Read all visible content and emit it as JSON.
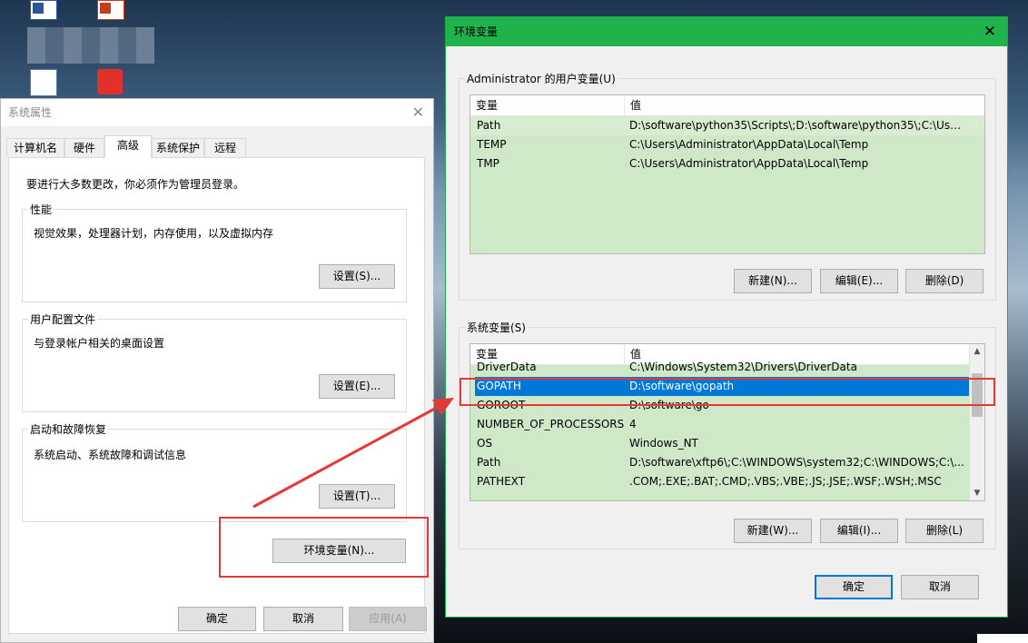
{
  "system_properties": {
    "title": "系统属性",
    "tabs": [
      {
        "label": "计算机名"
      },
      {
        "label": "硬件"
      },
      {
        "label": "高级"
      },
      {
        "label": "系统保护"
      },
      {
        "label": "远程"
      }
    ],
    "notice": "要进行大多数更改，你必须作为管理员登录。",
    "performance": {
      "label": "性能",
      "desc": "视觉效果，处理器计划，内存使用，以及虚拟内存",
      "button": "设置(S)..."
    },
    "user_profiles": {
      "label": "用户配置文件",
      "desc": "与登录帐户相关的桌面设置",
      "button": "设置(E)..."
    },
    "startup_recovery": {
      "label": "启动和故障恢复",
      "desc": "系统启动、系统故障和调试信息",
      "button": "设置(T)..."
    },
    "env_button": "环境变量(N)...",
    "ok": "确定",
    "cancel": "取消",
    "apply": "应用(A)"
  },
  "env_vars": {
    "title": "环境变量",
    "user_group_label": "Administrator 的用户变量(U)",
    "system_group_label": "系统变量(S)",
    "col_var": "变量",
    "col_val": "值",
    "user_rows": [
      {
        "name": "Path",
        "value": "D:\\software\\python35\\Scripts\\;D:\\software\\python35\\;C:\\User..."
      },
      {
        "name": "TEMP",
        "value": "C:\\Users\\Administrator\\AppData\\Local\\Temp"
      },
      {
        "name": "TMP",
        "value": "C:\\Users\\Administrator\\AppData\\Local\\Temp"
      }
    ],
    "system_rows": [
      {
        "name": "DriverData",
        "value": "C:\\Windows\\System32\\Drivers\\DriverData"
      },
      {
        "name": "GOPATH",
        "value": "D:\\software\\gopath"
      },
      {
        "name": "GOROOT",
        "value": "D:\\software\\go"
      },
      {
        "name": "NUMBER_OF_PROCESSORS",
        "value": "4"
      },
      {
        "name": "OS",
        "value": "Windows_NT"
      },
      {
        "name": "Path",
        "value": "D:\\software\\xftp6\\;C:\\WINDOWS\\system32;C:\\WINDOWS;C:\\..."
      },
      {
        "name": "PATHEXT",
        "value": ".COM;.EXE;.BAT;.CMD;.VBS;.VBE;.JS;.JSE;.WSF;.WSH;.MSC"
      }
    ],
    "user_buttons": {
      "new": "新建(N)...",
      "edit": "编辑(E)...",
      "delete": "删除(D)"
    },
    "system_buttons": {
      "new": "新建(W)...",
      "edit": "编辑(I)...",
      "delete": "删除(L)"
    },
    "ok": "确定",
    "cancel": "取消"
  },
  "colors": {
    "annotation_red": "#e53935",
    "title_green": "#21b34b",
    "row_green": "#cfe9c8",
    "selection_blue": "#0078d7"
  }
}
